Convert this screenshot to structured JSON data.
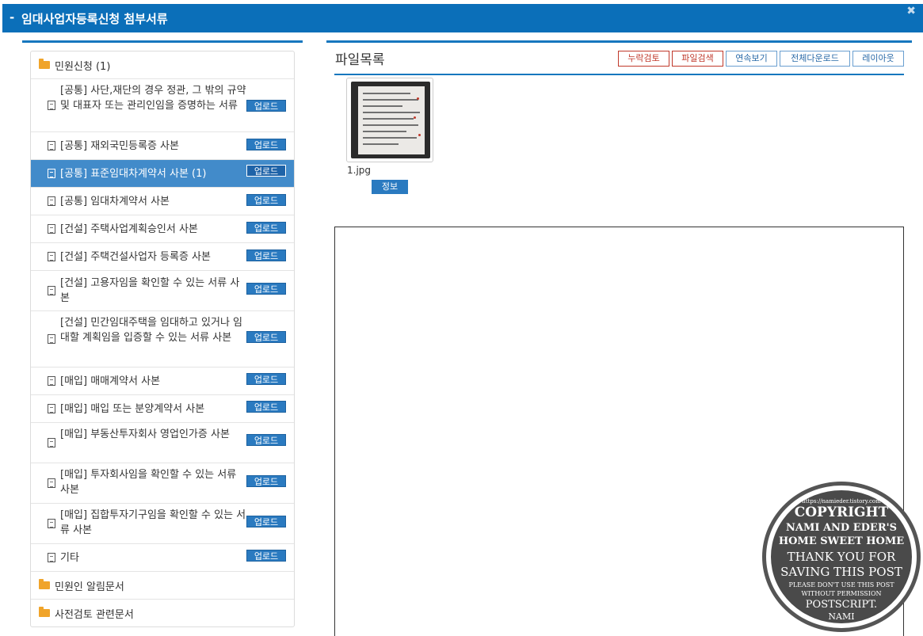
{
  "window": {
    "title": "임대사업자등록신청 첨부서류",
    "collapse_glyph": "-",
    "close_glyph": "✖"
  },
  "tree": {
    "folders": [
      {
        "label": "민원신청 (1)"
      },
      {
        "label": "민원인 알림문서"
      },
      {
        "label": "사전검토 관련문서"
      }
    ],
    "upload_label": "업로드",
    "items": [
      {
        "label": "[공통] 사단,재단의 경우 정관, 그 밖의 규약 및 대표자 또는 관리인임을 증명하는 서류"
      },
      {
        "label": "[공통] 재외국민등록증 사본"
      },
      {
        "label": "[공통] 표준임대차계약서 사본 (1)",
        "selected": true
      },
      {
        "label": "[공통] 임대차계약서 사본"
      },
      {
        "label": "[건설] 주택사업계획승인서 사본"
      },
      {
        "label": "[건설] 주택건설사업자 등록증 사본"
      },
      {
        "label": "[건설] 고용자임을 확인할 수 있는 서류 사본"
      },
      {
        "label": "[건설] 민간임대주택을 임대하고 있거나 임대할 계획임을 입증할 수 있는 서류 사본"
      },
      {
        "label": "[매입] 매매계약서 사본"
      },
      {
        "label": "[매입] 매입 또는 분양계약서 사본"
      },
      {
        "label": "[매입] 부동산투자회사 영업인가증 사본"
      },
      {
        "label": "[매입] 투자회사임을 확인할 수 있는 서류 사본"
      },
      {
        "label": "[매입] 집합투자기구임을 확인할 수 있는 서류 사본"
      },
      {
        "label": "기타"
      }
    ]
  },
  "file_panel": {
    "title": "파일목록",
    "buttons": {
      "omission_check": "누락검토",
      "file_search": "파일검색",
      "continuous_view": "연속보기",
      "download_all": "전체다운로드",
      "layout": "레이아웃"
    },
    "file": {
      "name": "1.jpg",
      "info_label": "정보"
    }
  },
  "watermark": {
    "url": "https://namieder.tistory.com",
    "lines": [
      "COPYRIGHT",
      "NAMI AND EDER'S",
      "HOME SWEET HOME",
      "THANK YOU FOR",
      "SAVING THIS POST",
      "PLEASE DON'T USE THIS POST",
      "WITHOUT PERMISSION",
      "POSTSCRIPT.",
      "NAMI"
    ]
  },
  "colors": {
    "header": "#0b6fb9",
    "accent": "#1677be",
    "selected_row": "#428bca",
    "upload_button": "#2a7ac0",
    "danger_button": "#c0392b",
    "folder": "#f0a42a"
  }
}
